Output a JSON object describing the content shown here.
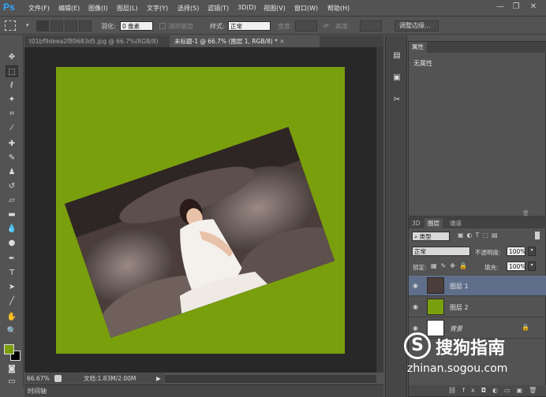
{
  "app": {
    "logo": "Ps"
  },
  "menu": [
    "文件(F)",
    "编辑(E)",
    "图像(I)",
    "图层(L)",
    "文字(Y)",
    "选择(S)",
    "滤镜(T)",
    "3D(D)",
    "视图(V)",
    "窗口(W)",
    "帮助(H)"
  ],
  "window_controls": {
    "minimize": "—",
    "restore": "❐",
    "close": "✕"
  },
  "options": {
    "feather_label": "羽化:",
    "feather_value": "0 像素",
    "antialias_label": "消除锯齿",
    "style_label": "样式:",
    "style_value": "正常",
    "width_label": "宽度:",
    "height_label": "高度:",
    "refine_edge": "调整边缘..."
  },
  "tabs": [
    {
      "label": "t01bf9deea2f89683d5.jpg @ 66.7%(RGB/8)",
      "active": false
    },
    {
      "label": "未标题-1 @ 66.7% (图层 1, RGB/8) *",
      "active": true
    }
  ],
  "status": {
    "zoom": "66.67%",
    "doc": "文档:1.83M/2.00M"
  },
  "timeline": "时间轴",
  "properties": {
    "tab": "属性",
    "content": "无属性"
  },
  "layers_panel": {
    "tabs": [
      "3D",
      "图层",
      "通道"
    ],
    "filter_kind": "类型",
    "blend_mode": "正常",
    "opacity_label": "不透明度:",
    "opacity_value": "100%",
    "lock_label": "锁定:",
    "fill_label": "填充:",
    "fill_value": "100%",
    "layers": [
      {
        "name": "图层 1",
        "selected": true,
        "thumb": "photo"
      },
      {
        "name": "图层 2",
        "selected": false,
        "thumb": "#7a9f0d"
      },
      {
        "name": "背景",
        "selected": false,
        "thumb": "#ffffff",
        "locked": true
      }
    ]
  },
  "colors": {
    "foreground": "#7a9f0d",
    "background": "#000000",
    "canvas": "#7a9f0d"
  },
  "watermark": {
    "brand": "搜狗指南",
    "url": "zhinan.sogou.com"
  }
}
